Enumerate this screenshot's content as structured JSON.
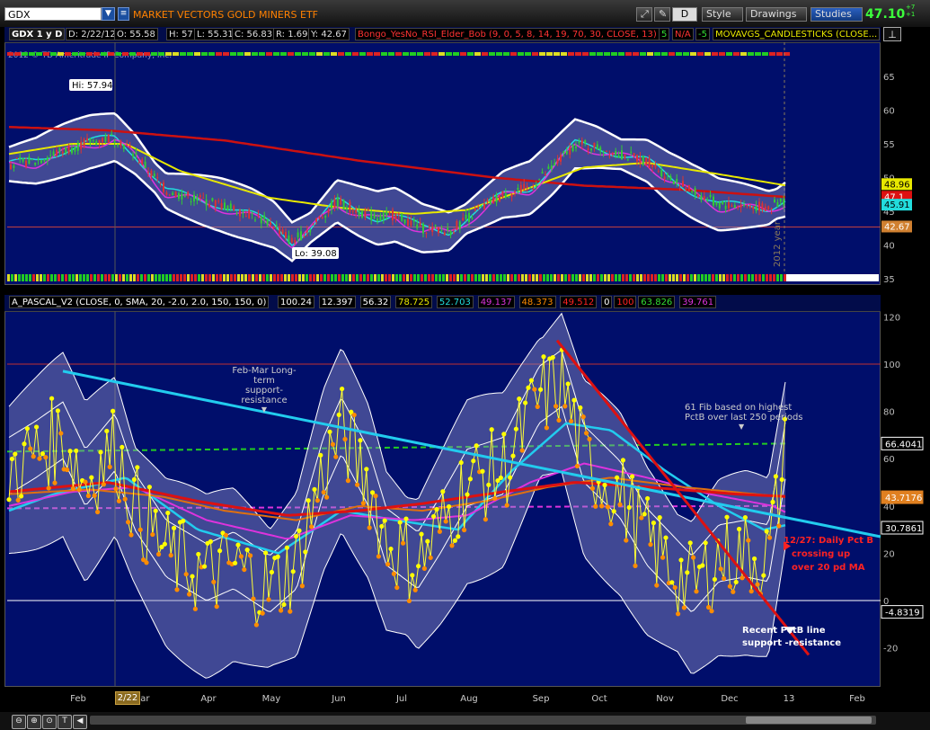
{
  "toolbar": {
    "symbol": "GDX",
    "description": "MARKET VECTORS GOLD MINERS ETF",
    "d_label": "D",
    "style_label": "Style",
    "drawings_label": "Drawings",
    "studies_label": "Studies",
    "last_price": "47.10",
    "change_line1": "+7",
    "change_line2": "+1"
  },
  "upper_header": {
    "symbol_period": "GDX 1 y D",
    "date": "D: 2/22/12",
    "open": "O: 55.58",
    "high": "H: 57",
    "low": "L: 55.31",
    "close": "C: 56.83",
    "range": "R: 1.69",
    "y": "Y: 42.67",
    "study1": "Bongo_YesNo_RSI_Elder_Bob (9, 0, 5, 8, 14, 19, 70, 30, CLOSE, 13)",
    "study1_v1": "5",
    "study1_v2": "N/A",
    "study1_v3": "-5",
    "study2": "MOVAVGS_CANDLESTICKS (CLOSE..."
  },
  "upper_chart": {
    "copyright": "2012 © TD Ameritrade IP Company, Inc.",
    "hi_label": "Hi: 57.94",
    "lo_label": "Lo: 39.08",
    "year_label": "2012 year",
    "y_ticks": [
      "65",
      "60",
      "55",
      "50",
      "45",
      "40",
      "35"
    ],
    "price_tags": {
      "a": "48.96",
      "b": "47.1",
      "c": "45.91",
      "d": "42.67"
    },
    "colors": {
      "background": "#000e6b",
      "sma200": "#cc1111",
      "sma50": "#e8e800",
      "band": "#ffffff",
      "fast_cyan": "#22dddd",
      "fast_magenta": "#dd33dd",
      "candle_up": "#33cc33",
      "candle_down": "#dd3333"
    }
  },
  "lower_header": {
    "study": "A_PASCAL_V2 (CLOSE, 0, SMA, 20, -2.0, 2.0, 150, 150, 0)",
    "values": [
      "100.24",
      "12.397",
      "56.32",
      "78.725",
      "52.703",
      "49.137",
      "48.373",
      "49.512",
      "0",
      "100",
      "63.826",
      "39.761"
    ],
    "value_colors": [
      "#ffffff",
      "#ffffff",
      "#ffffff",
      "#e8e800",
      "#22dddd",
      "#dd33dd",
      "#ff8c00",
      "#ff2222",
      "#ffffff",
      "#ff2222",
      "#33dd33",
      "#dd33dd"
    ]
  },
  "lower_chart": {
    "y_ticks": [
      "120",
      "100",
      "80",
      "60",
      "40",
      "20",
      "0",
      "-20"
    ],
    "price_tags": {
      "a": "66.4041",
      "b": "43.7176",
      "c": "30.7861",
      "d": "-4.8319"
    },
    "annotations": {
      "feb_mar_1": "Feb-Mar Long-term",
      "feb_mar_2": "support-resistance",
      "fib_1": "61 Fib based on highest",
      "fib_2": "PctB over last 250 periods",
      "pctb_1": "12/27:  Daily Pct B",
      "pctb_2": "crossing up",
      "pctb_3": "over 20 pd MA",
      "recent_1": "Recent PctB line",
      "recent_2": "support -resistance"
    },
    "colors": {
      "pctb_line": "#ffff33",
      "pctb_dot_up": "#ffff00",
      "pctb_dot_down": "#ff8c00",
      "trend_cyan": "#22ccee",
      "trend_red": "#dd1111",
      "fib_green": "#22cc22",
      "ma_magenta": "#dd33dd",
      "ma_orange": "#e07010"
    }
  },
  "x_axis": {
    "months": [
      "Feb",
      "Mar",
      "Apr",
      "May",
      "Jun",
      "Jul",
      "Aug",
      "Sep",
      "Oct",
      "Nov",
      "Dec",
      "13",
      "Feb"
    ],
    "cursor_date": "2/22"
  },
  "chart_data": [
    {
      "type": "line",
      "title": "GDX 1 y D",
      "ylim": [
        35,
        66
      ],
      "x": [
        "Feb",
        "Mar",
        "Apr",
        "May",
        "Jun",
        "Jul",
        "Aug",
        "Sep",
        "Oct",
        "Nov",
        "Dec",
        "13"
      ],
      "series": [
        {
          "values": [
            53.5,
            55.8,
            50.0,
            43.5,
            47.5,
            43.0,
            44.5,
            51.0,
            54.5,
            50.5,
            46.0,
            46.5
          ]
        }
      ],
      "annotations": [
        "Hi: 57.94",
        "Lo: 39.08"
      ],
      "grid": false
    },
    {
      "type": "line",
      "title": "A_PASCAL_V2",
      "ylim": [
        -25,
        120
      ],
      "x": [
        "Feb",
        "Mar",
        "Apr",
        "May",
        "Jun",
        "Jul",
        "Aug",
        "Sep",
        "Oct",
        "Nov",
        "Dec",
        "13"
      ],
      "series": [
        {
          "values": [
            60,
            65,
            20,
            10,
            70,
            25,
            35,
            95,
            60,
            15,
            20,
            66.4
          ]
        },
        {
          "values": [
            40,
            48,
            32,
            22,
            45,
            34,
            33,
            55,
            70,
            48,
            32,
            30.8
          ]
        }
      ],
      "reference_lines": [
        100,
        66.4,
        0
      ],
      "grid": false
    }
  ]
}
